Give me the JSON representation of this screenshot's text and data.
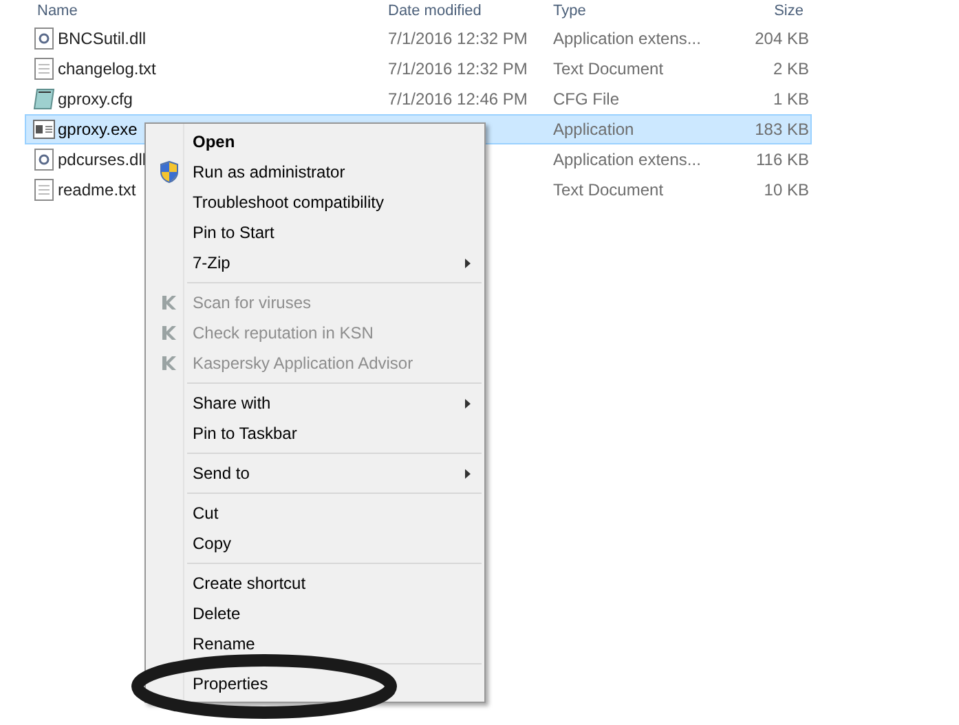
{
  "columns": [
    "Name",
    "Date modified",
    "Type",
    "Size"
  ],
  "files": [
    {
      "name": "BNCSutil.dll",
      "date": "7/1/2016 12:32 PM",
      "type": "Application extens...",
      "size": "204 KB",
      "kind": "library",
      "selected": false
    },
    {
      "name": "changelog.txt",
      "date": "7/1/2016 12:32 PM",
      "type": "Text Document",
      "size": "2 KB",
      "kind": "text",
      "selected": false
    },
    {
      "name": "gproxy.cfg",
      "date": "7/1/2016 12:46 PM",
      "type": "CFG File",
      "size": "1 KB",
      "kind": "config",
      "selected": false
    },
    {
      "name": "gproxy.exe",
      "type": "Application",
      "size": "183 KB",
      "kind": "program",
      "selected": true
    },
    {
      "name": "pdcurses.dll",
      "type": "Application extens...",
      "size": "116 KB",
      "kind": "library",
      "selected": false
    },
    {
      "name": "readme.txt",
      "type": "Text Document",
      "size": "10 KB",
      "kind": "text",
      "selected": false
    }
  ],
  "context_menu": [
    {
      "kind": "plain",
      "label": "Open",
      "default": true,
      "disabled": false,
      "submenu": false
    },
    {
      "kind": "shield",
      "label": "Run as administrator",
      "default": false,
      "disabled": false,
      "submenu": false
    },
    {
      "kind": "plain",
      "label": "Troubleshoot compatibility",
      "default": false,
      "disabled": false,
      "submenu": false
    },
    {
      "kind": "plain",
      "label": "Pin to Start",
      "default": false,
      "disabled": false,
      "submenu": false
    },
    {
      "kind": "plain",
      "label": "7-Zip",
      "default": false,
      "disabled": false,
      "submenu": true
    },
    {
      "kind": "separator"
    },
    {
      "kind": "antivirus",
      "label": "Scan for viruses",
      "default": false,
      "disabled": true,
      "submenu": false
    },
    {
      "kind": "antivirus",
      "label": "Check reputation in KSN",
      "default": false,
      "disabled": true,
      "submenu": false
    },
    {
      "kind": "antivirus",
      "label": "Kaspersky Application Advisor",
      "default": false,
      "disabled": true,
      "submenu": false
    },
    {
      "kind": "separator"
    },
    {
      "kind": "plain",
      "label": "Share with",
      "default": false,
      "disabled": false,
      "submenu": true
    },
    {
      "kind": "plain",
      "label": "Pin to Taskbar",
      "default": false,
      "disabled": false,
      "submenu": false
    },
    {
      "kind": "separator"
    },
    {
      "kind": "plain",
      "label": "Send to",
      "default": false,
      "disabled": false,
      "submenu": true
    },
    {
      "kind": "separator"
    },
    {
      "kind": "plain",
      "label": "Cut",
      "default": false,
      "disabled": false,
      "submenu": false
    },
    {
      "kind": "plain",
      "label": "Copy",
      "default": false,
      "disabled": false,
      "submenu": false
    },
    {
      "kind": "separator"
    },
    {
      "kind": "plain",
      "label": "Create shortcut",
      "default": false,
      "disabled": false,
      "submenu": false
    },
    {
      "kind": "plain",
      "label": "Delete",
      "default": false,
      "disabled": false,
      "submenu": false
    },
    {
      "kind": "plain",
      "label": "Rename",
      "default": false,
      "disabled": false,
      "submenu": false
    },
    {
      "kind": "separator"
    },
    {
      "kind": "plain",
      "label": "Properties",
      "default": false,
      "disabled": false,
      "submenu": false
    }
  ]
}
